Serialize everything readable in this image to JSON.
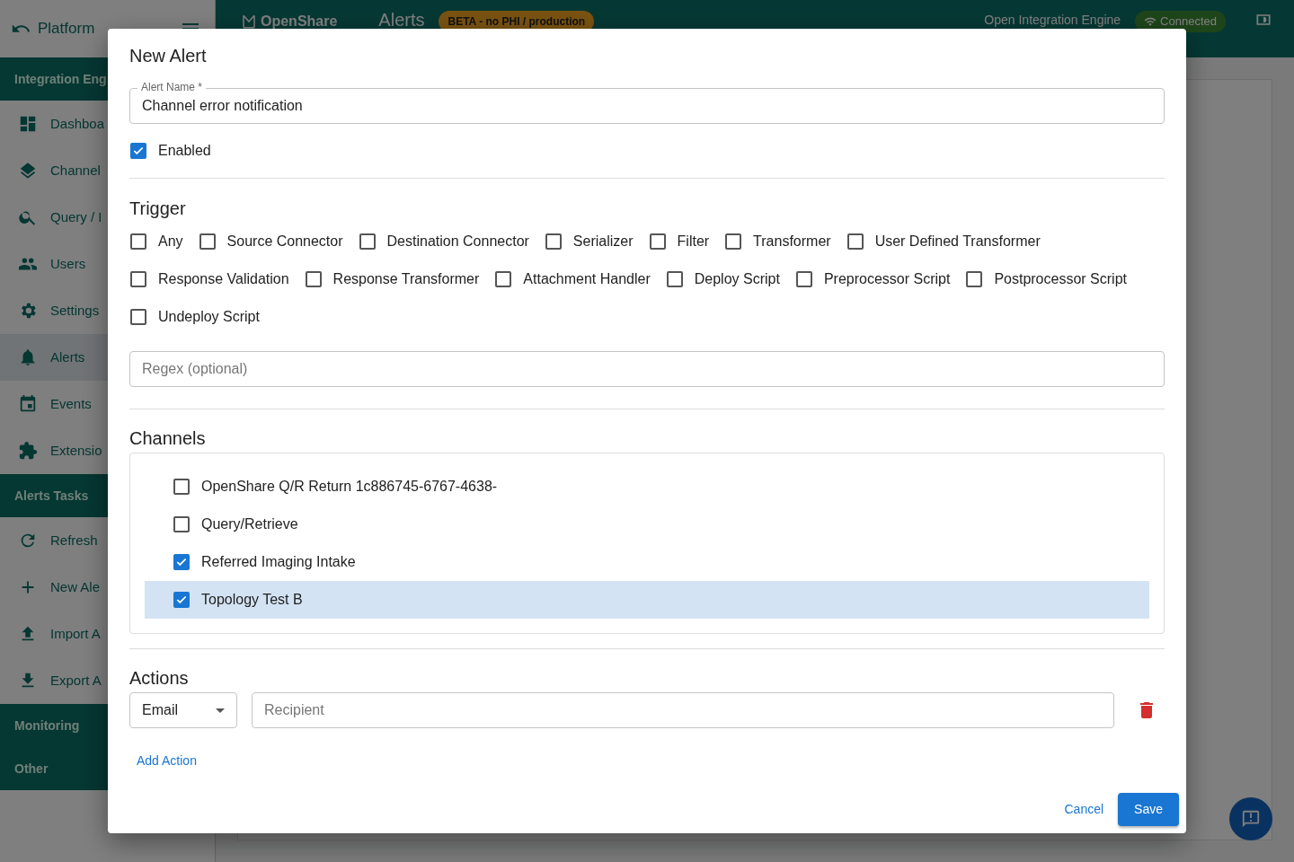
{
  "sidebar": {
    "title": "Platform",
    "sections": [
      {
        "heading": "Integration Eng",
        "items": [
          {
            "label": "Dashboa",
            "selected": false
          },
          {
            "label": "Channel",
            "selected": false
          },
          {
            "label": "Query / I",
            "selected": false
          },
          {
            "label": "Users",
            "selected": false
          },
          {
            "label": "Settings",
            "selected": false
          },
          {
            "label": "Alerts",
            "selected": true
          },
          {
            "label": "Events",
            "selected": false
          },
          {
            "label": "Extensio",
            "selected": false
          }
        ]
      },
      {
        "heading": "Alerts Tasks",
        "items": [
          {
            "label": "Refresh",
            "selected": false
          },
          {
            "label": "New Ale",
            "selected": false
          },
          {
            "label": "Import A",
            "selected": false
          },
          {
            "label": "Export A",
            "selected": false
          }
        ]
      },
      {
        "heading": "Monitoring"
      },
      {
        "heading": "Other"
      }
    ]
  },
  "header": {
    "brand": "OpenShare",
    "page_title": "Alerts",
    "badge": "BETA - no PHI / production",
    "engine": "Open Integration Engine",
    "status": "Connected"
  },
  "dialog": {
    "title": "New Alert",
    "name_field": {
      "label": "Alert Name *",
      "value": "Channel error notification"
    },
    "enabled": {
      "label": "Enabled",
      "checked": true
    },
    "trigger": {
      "heading": "Trigger",
      "options": [
        {
          "label": "Any",
          "checked": false
        },
        {
          "label": "Source Connector",
          "checked": false
        },
        {
          "label": "Destination Connector",
          "checked": false
        },
        {
          "label": "Serializer",
          "checked": false
        },
        {
          "label": "Filter",
          "checked": false
        },
        {
          "label": "Transformer",
          "checked": false
        },
        {
          "label": "User Defined Transformer",
          "checked": false
        },
        {
          "label": "Response Validation",
          "checked": false
        },
        {
          "label": "Response Transformer",
          "checked": false
        },
        {
          "label": "Attachment Handler",
          "checked": false
        },
        {
          "label": "Deploy Script",
          "checked": false
        },
        {
          "label": "Preprocessor Script",
          "checked": false
        },
        {
          "label": "Postprocessor Script",
          "checked": false
        },
        {
          "label": "Undeploy Script",
          "checked": false
        }
      ],
      "regex_placeholder": "Regex (optional)"
    },
    "channels": {
      "heading": "Channels",
      "items": [
        {
          "label": "OpenShare Q/R Return 1c886745-6767-4638-",
          "checked": false,
          "selected": false
        },
        {
          "label": "Query/Retrieve",
          "checked": false,
          "selected": false
        },
        {
          "label": "Referred Imaging Intake",
          "checked": true,
          "selected": false
        },
        {
          "label": "Topology Test B",
          "checked": true,
          "selected": true
        }
      ]
    },
    "actions": {
      "heading": "Actions",
      "rows": [
        {
          "type": "Email",
          "placeholder": "Recipient"
        }
      ],
      "add_label": "Add Action"
    },
    "buttons": {
      "cancel": "Cancel",
      "save": "Save"
    }
  }
}
